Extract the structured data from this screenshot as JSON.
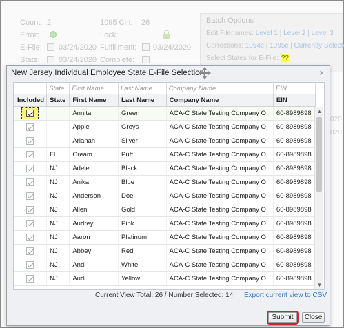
{
  "background": {
    "count_label": "Count:",
    "count_value": "2",
    "cnt1095_label": "1095 Cnt:",
    "cnt1095_value": "26",
    "error_label": "Error:",
    "lock_label": "Lock:",
    "efile_label": "E-File:",
    "efile_date": "03/24/2020",
    "fulfillment_label": "Fulfillment:",
    "fulfillment_date": "03/24/2020",
    "state_label": "State:",
    "state_date": "03/24/2020",
    "complete_label": "Complete:",
    "batch_title": "Batch Options",
    "edit_filenames_label": "Edit Filenames:",
    "level1": "Level 1",
    "level2": "Level 2",
    "level3": "Level 3",
    "corrections_label": "Corrections:",
    "corr_1094c": "1094c",
    "corr_1095c": "1095c",
    "corr_current": "Currently Selected",
    "select_states_label": "Select States for E-File:",
    "select_states_value": "??",
    "side_year": "020"
  },
  "modal": {
    "title": "New Jersey Individual Employee State E-File Selection",
    "close_glyph": "×",
    "filters": {
      "state": "State",
      "first_name": "First Name",
      "last_name": "Last Name",
      "company_name": "Company Name",
      "ein": "EIN"
    },
    "columns": {
      "included": "Included",
      "state": "State",
      "first_name": "First Name",
      "last_name": "Last Name",
      "company_name": "Company Name",
      "ein": "EIN"
    },
    "rows": [
      {
        "included": true,
        "state": "",
        "first": "Annita",
        "last": "Green",
        "company": "ACA-C State Testing Company O",
        "ein": "60-8989898"
      },
      {
        "included": true,
        "state": "",
        "first": "Apple",
        "last": "Greys",
        "company": "ACA-C State Testing Company O",
        "ein": "60-8989898"
      },
      {
        "included": true,
        "state": "",
        "first": "Arianah",
        "last": "Silver",
        "company": "ACA-C State Testing Company O",
        "ein": "60-8989898"
      },
      {
        "included": true,
        "state": "FL",
        "first": "Cream",
        "last": "Puff",
        "company": "ACA-C State Testing Company O",
        "ein": "60-8989898"
      },
      {
        "included": true,
        "state": "NJ",
        "first": "Adele",
        "last": "Black",
        "company": "ACA-C State Testing Company O",
        "ein": "60-8989898"
      },
      {
        "included": true,
        "state": "NJ",
        "first": "Anika",
        "last": "Blue",
        "company": "ACA-C State Testing Company O",
        "ein": "60-8989898"
      },
      {
        "included": true,
        "state": "NJ",
        "first": "Anderson",
        "last": "Doe",
        "company": "ACA-C State Testing Company O",
        "ein": "60-8989898"
      },
      {
        "included": true,
        "state": "NJ",
        "first": "Allen",
        "last": "Gold",
        "company": "ACA-C State Testing Company O",
        "ein": "60-8989898"
      },
      {
        "included": true,
        "state": "NJ",
        "first": "Audrey",
        "last": "Pink",
        "company": "ACA-C State Testing Company O",
        "ein": "60-8989898"
      },
      {
        "included": true,
        "state": "NJ",
        "first": "Aaron",
        "last": "Platinum",
        "company": "ACA-C State Testing Company O",
        "ein": "60-8989898"
      },
      {
        "included": true,
        "state": "NJ",
        "first": "Abbey",
        "last": "Red",
        "company": "ACA-C State Testing Company O",
        "ein": "60-8989898"
      },
      {
        "included": true,
        "state": "NJ",
        "first": "Andi",
        "last": "White",
        "company": "ACA-C State Testing Company O",
        "ein": "60-8989898"
      },
      {
        "included": true,
        "state": "NJ",
        "first": "Audi",
        "last": "Yellow",
        "company": "ACA-C State Testing Company O",
        "ein": "60-8989898"
      }
    ],
    "footer_status": "Current View Total: 26 / Number Selected: 14",
    "export_link": "Export current view to CSV",
    "submit_label": "Submit",
    "close_label": "Close"
  },
  "colors": {
    "submit_highlight": "#c8272d",
    "focus_checkbox": "#fff47a",
    "link": "#2b78c5"
  }
}
